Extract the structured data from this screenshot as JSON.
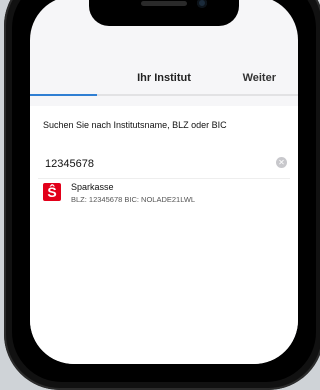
{
  "nav": {
    "title": "Ihr Institut",
    "action": "Weiter",
    "progress": 0.25
  },
  "search": {
    "hint": "Suchen Sie nach Institutsname, BLZ oder BIC",
    "value": "12345678",
    "placeholder": ""
  },
  "results": [
    {
      "name": "Sparkasse",
      "details": "BLZ: 12345678    BIC: NOLADE21LWL",
      "logo_color": "#e2001a"
    }
  ],
  "colors": {
    "accent": "#2f7fd3",
    "brand": "#e2001a"
  }
}
